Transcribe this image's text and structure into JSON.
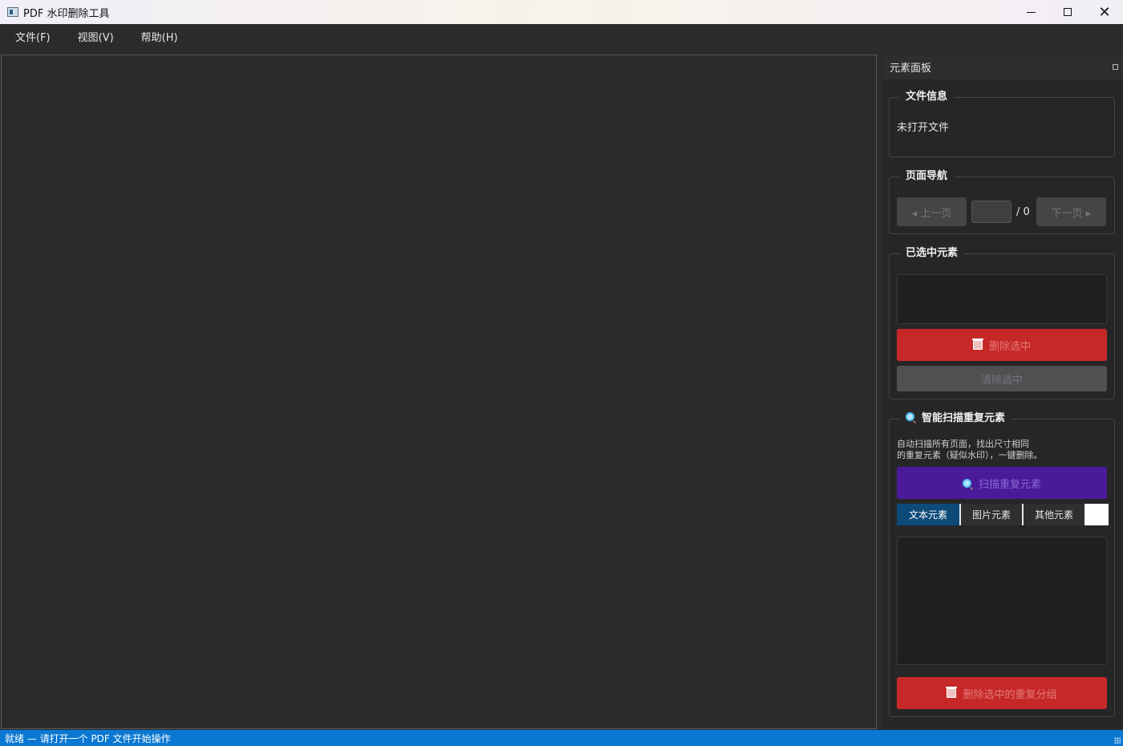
{
  "window": {
    "title": "PDF 水印删除工具",
    "controls": {
      "minimize": "—",
      "maximize": "☐",
      "close": "✕"
    }
  },
  "menubar": {
    "items": [
      "文件(F)",
      "视图(V)",
      "帮助(H)"
    ]
  },
  "panel": {
    "header": "元素面板",
    "file_info": {
      "title": "文件信息",
      "status": "未打开文件"
    },
    "page_nav": {
      "title": "页面导航",
      "prev_label": "◂ 上一页",
      "next_label": "下一页 ▸",
      "page_value": "",
      "total": "/ 0"
    },
    "selected": {
      "title": "已选中元素",
      "delete_label": "删除选中",
      "clear_label": "清除选中"
    },
    "scan": {
      "title": "智能扫描重复元素",
      "desc_line1": "自动扫描所有页面，找出尺寸相同",
      "desc_line2": "的重复元素（疑似水印），一键删除。",
      "scan_label": "扫描重复元素",
      "tabs": [
        "文本元素",
        "图片元素",
        "其他元素"
      ],
      "active_tab": "文本元素",
      "delete_group_label": "删除选中的重复分组"
    }
  },
  "statusbar": {
    "text": "就绪 — 请打开一个 PDF 文件开始操作"
  },
  "colors": {
    "accent_blue": "#0a78d2",
    "danger_red": "#c62828",
    "scan_purple": "#4a1a9a",
    "tab_active": "#0d4a78"
  }
}
